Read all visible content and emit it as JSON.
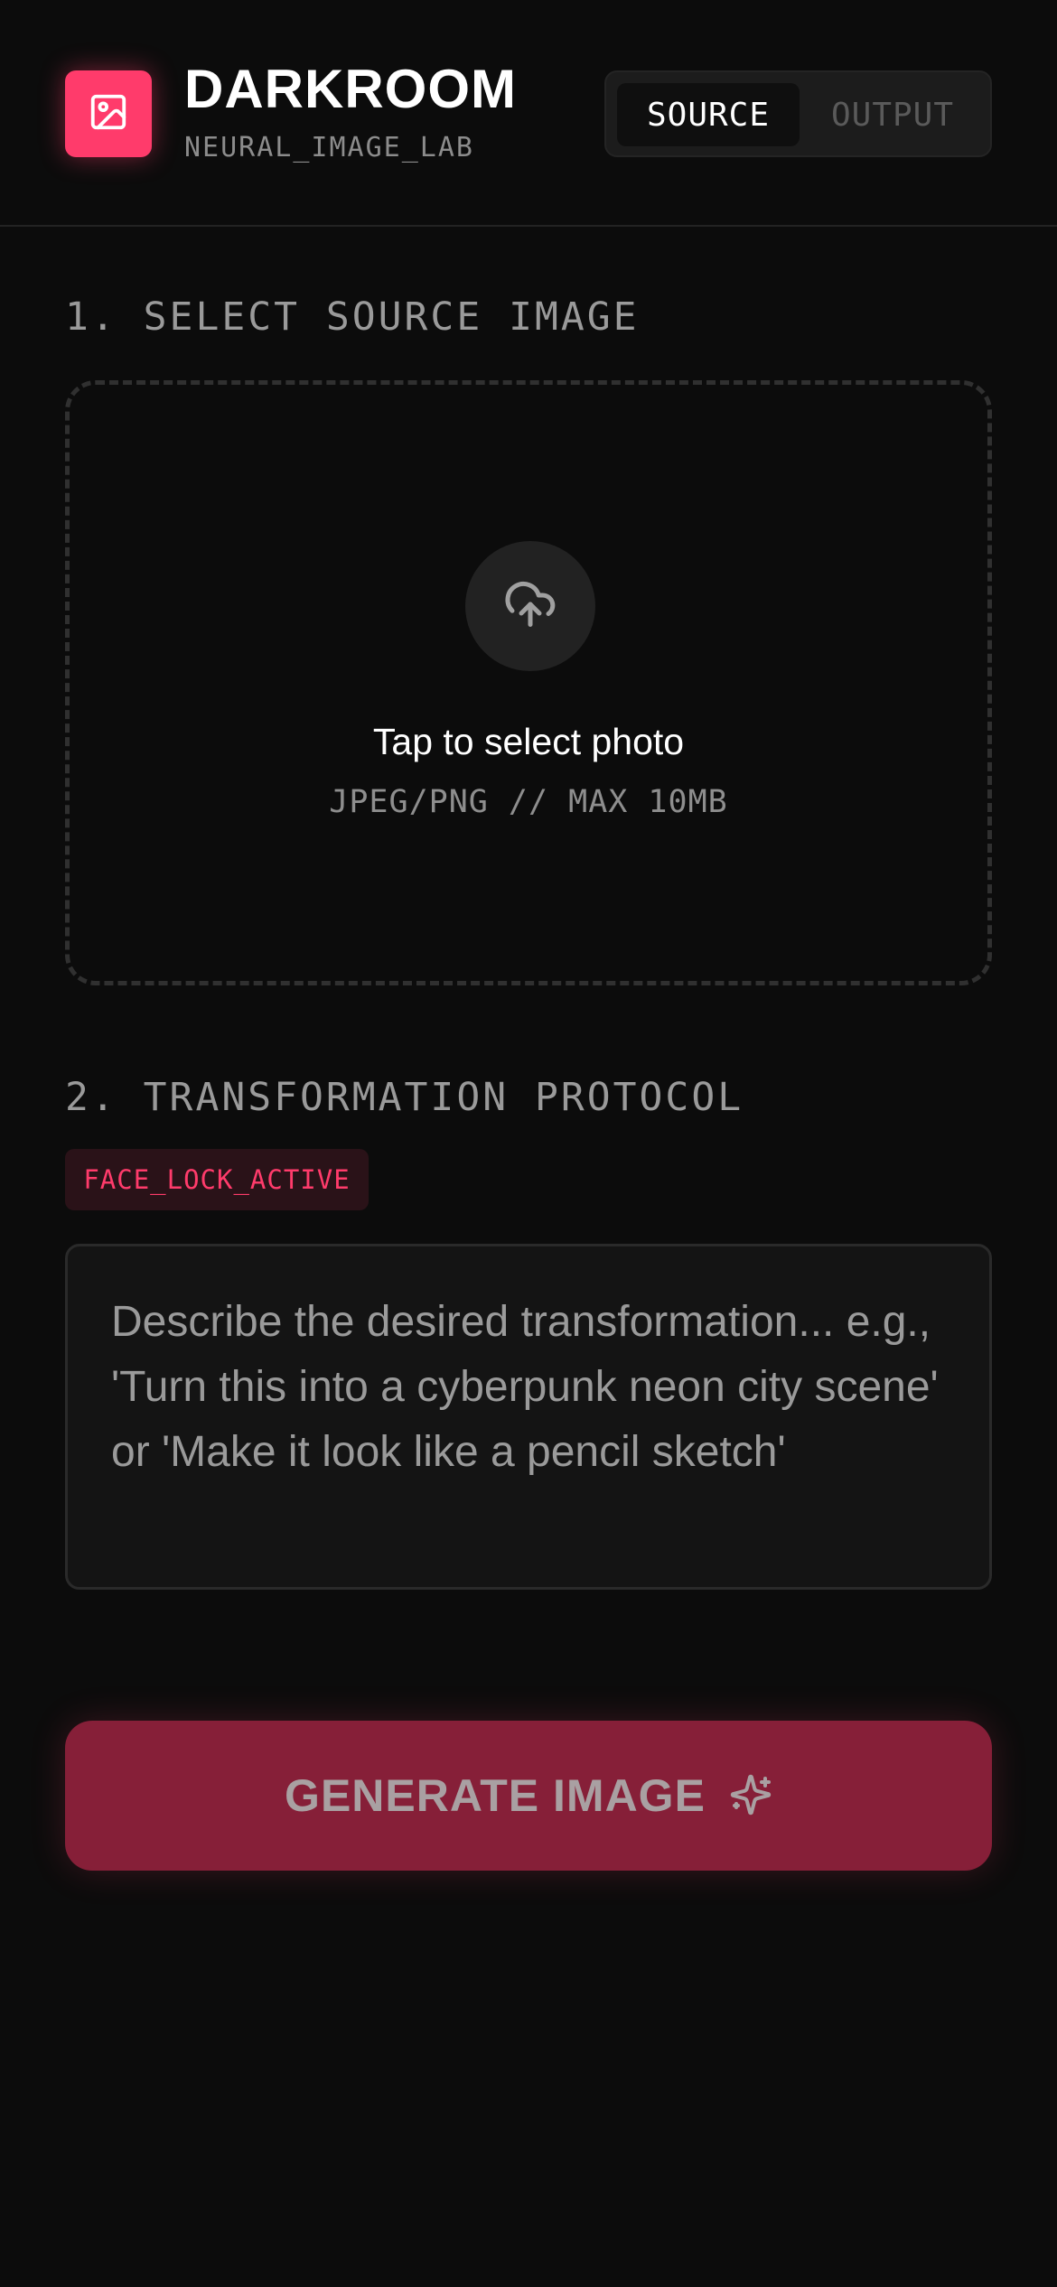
{
  "header": {
    "title": "DARKROOM",
    "subtitle": "NEURAL_IMAGE_LAB",
    "logo_icon": "image-icon",
    "accent_color": "#ff3b6b",
    "tabs": [
      {
        "label": "SOURCE",
        "active": true
      },
      {
        "label": "OUTPUT",
        "active": false
      }
    ]
  },
  "source": {
    "section_title": "1. SELECT SOURCE IMAGE",
    "upload_icon": "cloud-upload-icon",
    "drop_title": "Tap to select photo",
    "drop_subtitle": "JPEG/PNG // MAX 10MB"
  },
  "protocol": {
    "section_title": "2. TRANSFORMATION PROTOCOL",
    "badge": "FACE_LOCK_ACTIVE",
    "prompt_value": "",
    "prompt_placeholder": "Describe the desired transformation... e.g., 'Turn this into a cyberpunk neon city scene' or 'Make it look like a pencil sketch'"
  },
  "generate": {
    "label": "GENERATE IMAGE",
    "icon": "sparkles-icon",
    "color": "#861f38"
  }
}
